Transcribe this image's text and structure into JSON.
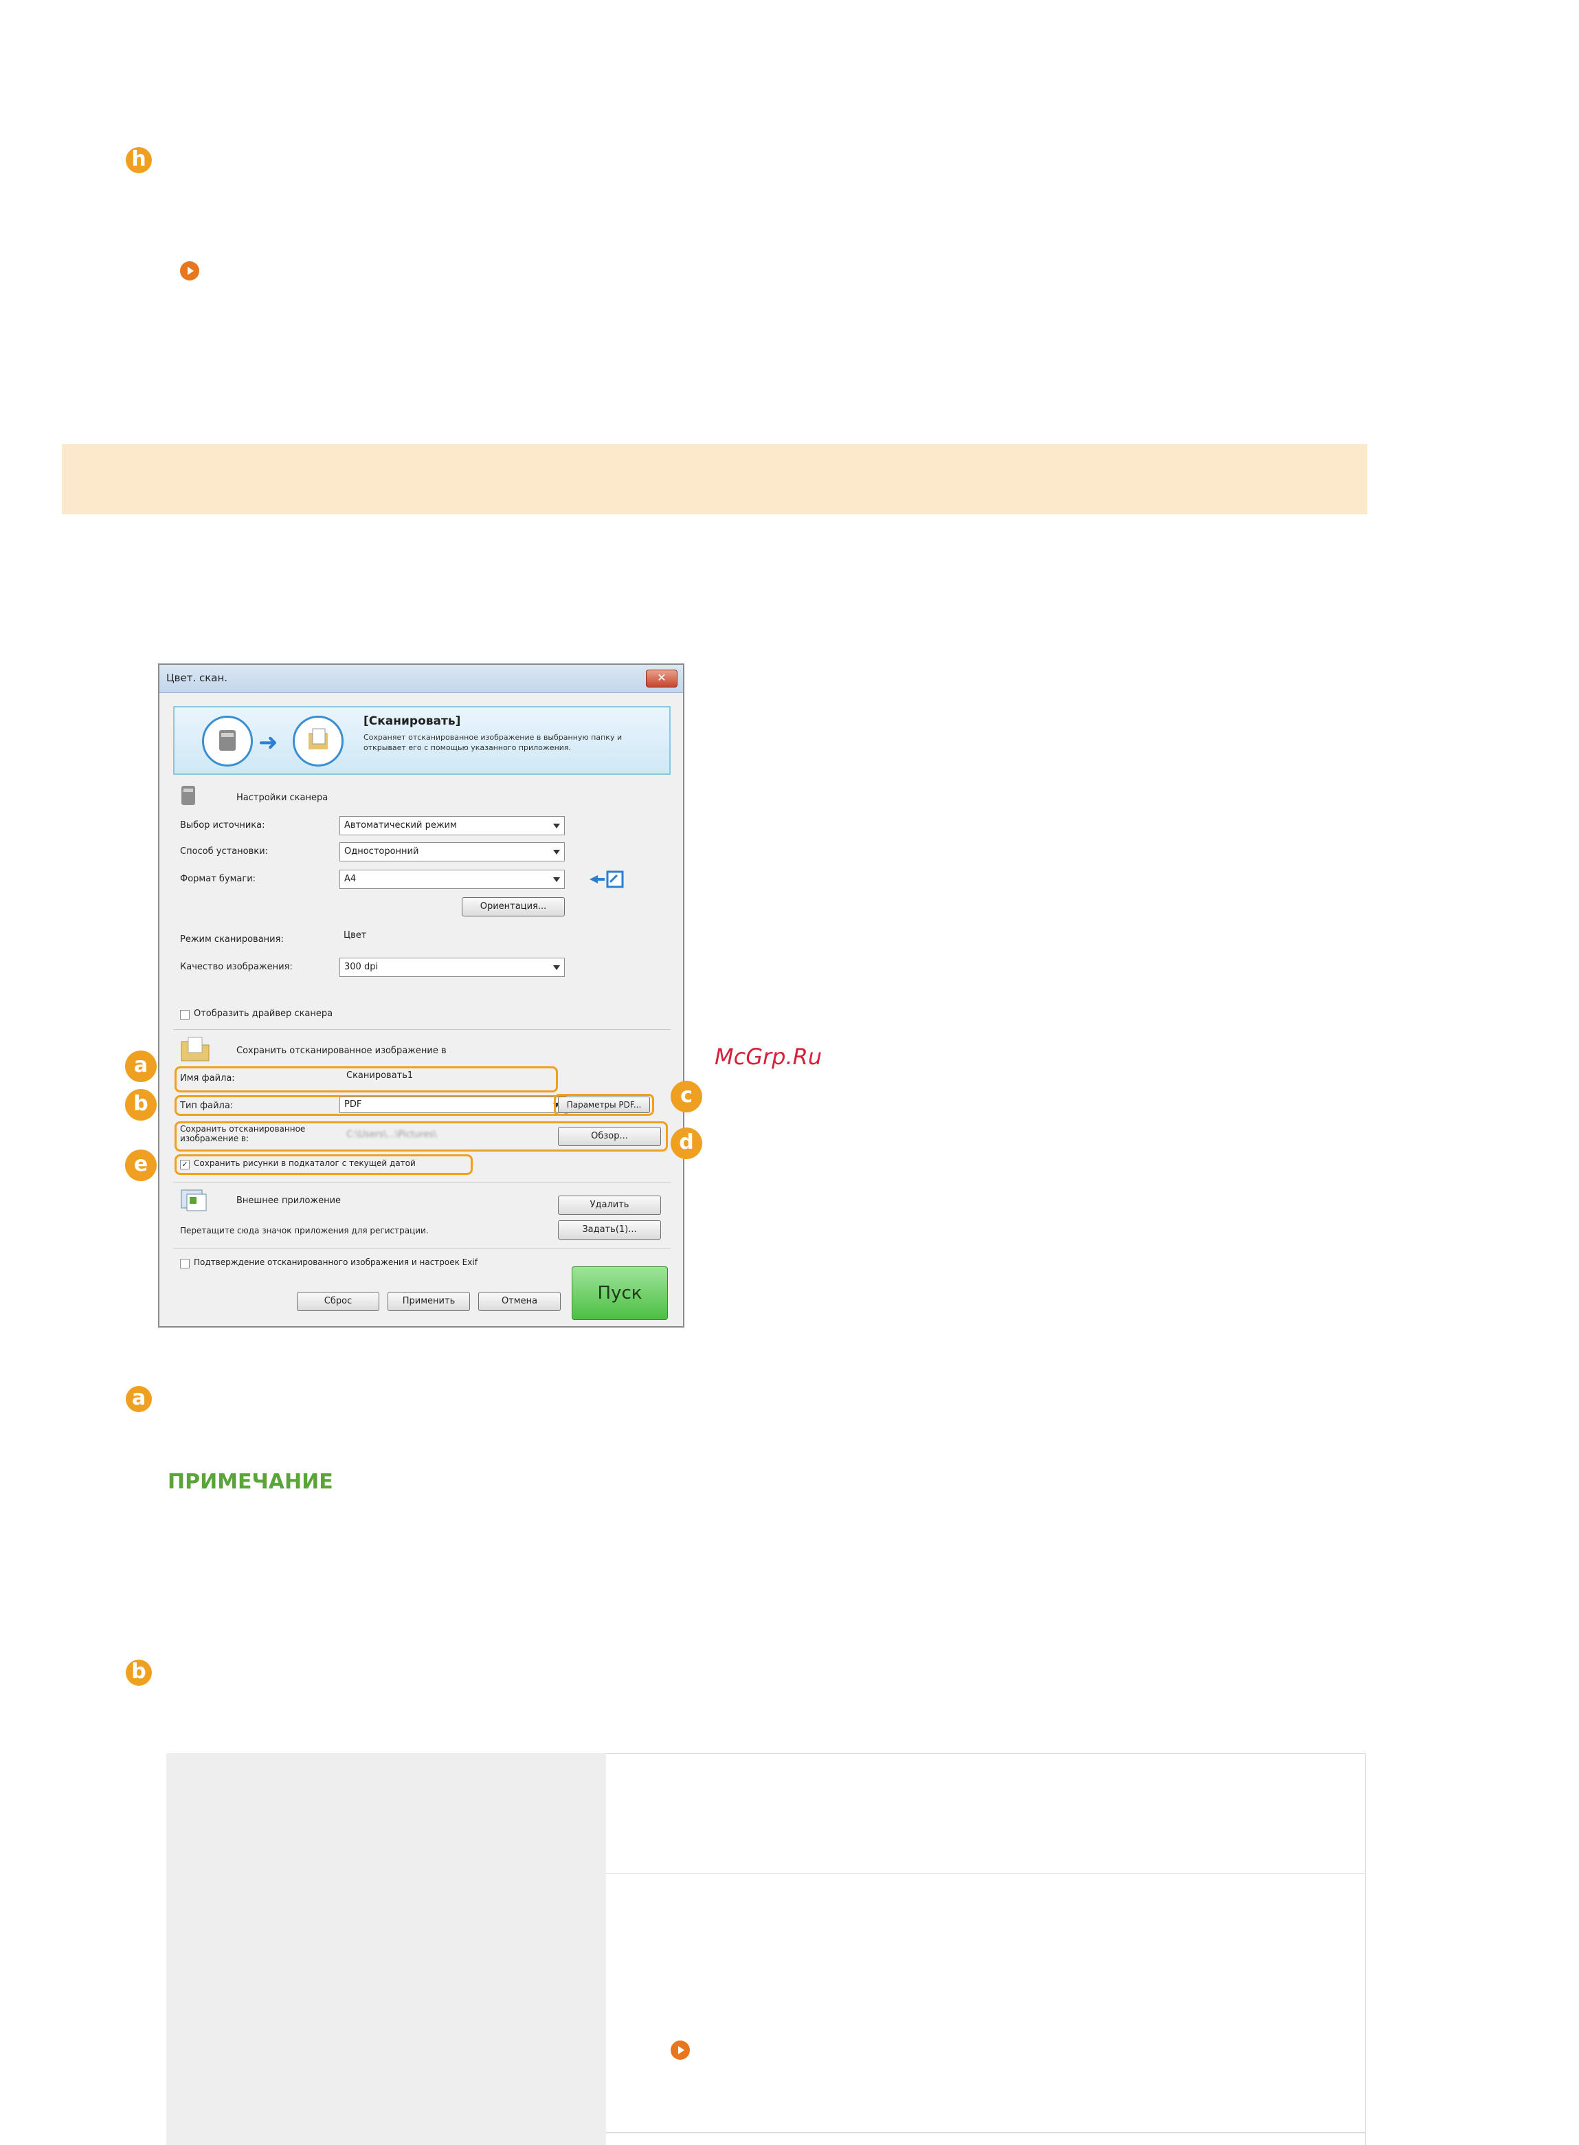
{
  "badges": {
    "h": "h",
    "a": "a",
    "b": "b",
    "c": "c",
    "d": "d",
    "e": "e"
  },
  "dialog": {
    "title": "Цвет. скан.",
    "close": "✕",
    "banner_title": "[Сканировать]",
    "banner_desc": "Сохраняет отсканированное изображение в выбранную папку и открывает его с помощью указанного приложения.",
    "scanner_settings": "Настройки сканера",
    "source_label": "Выбор источника:",
    "source_value": "Автоматический режим",
    "placement_label": "Способ установки:",
    "placement_value": "Односторонний",
    "paper_label": "Формат бумаги:",
    "paper_value": "A4",
    "orientation_button": "Ориентация...",
    "scan_mode_label": "Режим сканирования:",
    "scan_mode_value": "Цвет",
    "quality_label": "Качество изображения:",
    "quality_value": "300 dpi",
    "show_driver": "Отобразить драйвер сканера",
    "save_section": "Сохранить отсканированное изображение в",
    "filename_label": "Имя файла:",
    "filename_value": "Сканировать1",
    "filetype_label": "Тип файла:",
    "filetype_value": "PDF",
    "pdf_params_button": "Параметры PDF...",
    "save_to_label": "Сохранить отсканированное изображение в:",
    "save_to_value": "C:\\Users\\...\\Pictures\\",
    "browse_button": "Обзор...",
    "subfolder_check": "Сохранить рисунки в подкаталог с текущей датой",
    "ext_app": "Внешнее приложение",
    "delete_button": "Удалить",
    "drag_hint": "Перетащите сюда значок приложения для регистрации.",
    "set_button": "Задать(1)...",
    "confirm_check": "Подтверждение отсканированного изображения и настроек Exif",
    "reset_button": "Сброс",
    "apply_button": "Применить",
    "cancel_button": "Отмена",
    "start_button": "Пуск"
  },
  "watermark": "McGrp.Ru",
  "note_heading": "ПРИМЕЧАНИЕ",
  "colors": {
    "badge": "#f0a020",
    "arrow": "#e8761c",
    "band": "#fce9cc",
    "note": "#5aa43a",
    "watermark": "#d6213a"
  }
}
